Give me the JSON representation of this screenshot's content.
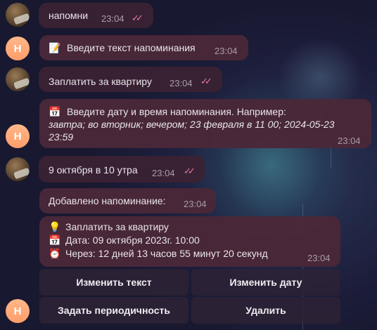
{
  "messages": {
    "m1": {
      "text": "напомни",
      "time": "23:04",
      "ticks": "✓✓"
    },
    "m2": {
      "icon": "📝",
      "text": "Введите текст напоминания",
      "time": "23:04"
    },
    "m3": {
      "text": "Заплатить за квартиру",
      "time": "23:04",
      "ticks": "✓✓"
    },
    "m4": {
      "icon": "📅",
      "line1": "Введите дату и время напоминания. Например:",
      "line2": "завтра; во вторник; вечером; 23 февраля в 11 00; 2024-05-23",
      "line3": "23:59",
      "time": "23:04"
    },
    "m5": {
      "text": "9 октября в 10 утра",
      "time": "23:04",
      "ticks": "✓✓"
    },
    "m6": {
      "text": "Добавлено напоминание:",
      "time": "23:04"
    },
    "m7": {
      "line1_icon": "💡",
      "line1": "Заплатить за квартиру",
      "line2_icon": "📅",
      "line2": "Дата: 09 октября 2023г. 10:00",
      "line3_icon": "⏰",
      "line3": "Через: 12 дней 13 часов 55 минут 20 секунд",
      "time": "23:04"
    }
  },
  "bot_avatar": {
    "letter": "Н"
  },
  "keyboard": {
    "edit_text": "Изменить текст",
    "edit_date": "Изменить дату",
    "set_period": "Задать периодичность",
    "delete": "Удалить"
  },
  "colors": {
    "accent_ticks": "#e879a8",
    "avatar": "#ff9d6a"
  }
}
